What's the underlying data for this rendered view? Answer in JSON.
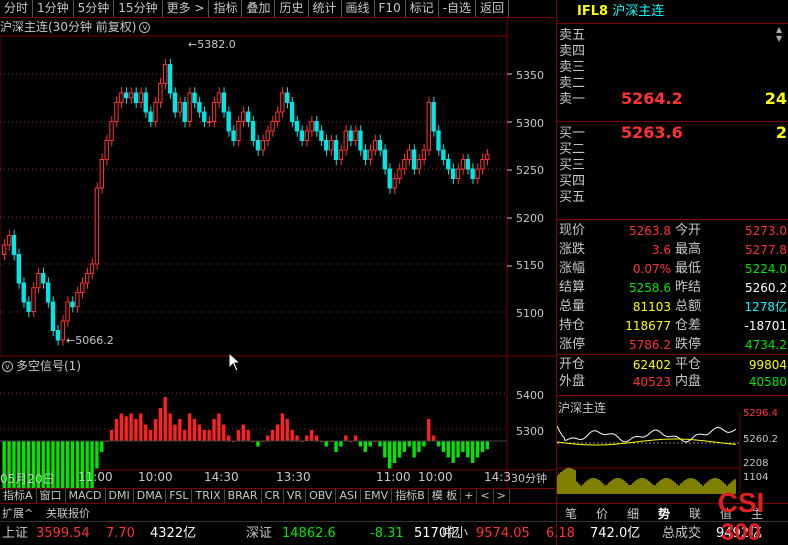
{
  "toolbar": [
    "分时",
    "1分钟",
    "5分钟",
    "15分钟",
    "更多 >",
    "指标",
    "叠加",
    "历史",
    "统计",
    "画线",
    "F10",
    "标记",
    "-自选",
    "返回"
  ],
  "chart_header": "沪深主连(30分钟 前复权)",
  "chart_header_icon": "v",
  "price_axis": [
    "5350",
    "5300",
    "5250",
    "5200",
    "5150",
    "5100"
  ],
  "high_label": "5382.0",
  "low_label": "5066.2",
  "indicator_header": "多空信号(1)",
  "indicator_axis": [
    "5400",
    "5300"
  ],
  "time_axis": [
    "05月20日",
    "11:00",
    "10:00",
    "14:30",
    "13:30",
    "11:00",
    "10:00",
    "14:3"
  ],
  "period_label": "30分钟",
  "chart_data": {
    "type": "candlestick",
    "title": "沪深主连(30分钟 前复权)",
    "ylim": [
      5060,
      5390
    ],
    "high": 5382.0,
    "low": 5066.2
  },
  "bottom_tabs": [
    "指标A",
    "窗口",
    "MACD",
    "DMI",
    "DMA",
    "FSL",
    "TRIX",
    "BRAR",
    "CR",
    "VR",
    "OBV",
    "ASI",
    "EMV",
    "指标B",
    "模 板",
    "+",
    "<",
    ">"
  ],
  "bottom_sub": [
    "扩展^",
    "关联报价"
  ],
  "side": {
    "code": "IFL8",
    "name": "沪深主连",
    "asks": [
      {
        "label": "卖五"
      },
      {
        "label": "卖四"
      },
      {
        "label": "卖三"
      },
      {
        "label": "卖二"
      },
      {
        "label": "卖一",
        "price": "5264.2",
        "vol": "24"
      }
    ],
    "bids": [
      {
        "label": "买一",
        "price": "5263.6",
        "vol": "2"
      },
      {
        "label": "买二"
      },
      {
        "label": "买三"
      },
      {
        "label": "买四"
      },
      {
        "label": "买五"
      }
    ],
    "stats": [
      {
        "l1": "现价",
        "v1": "5263.8",
        "l2": "今开",
        "v2": "5273.0"
      },
      {
        "l1": "涨跌",
        "v1": "3.6",
        "l2": "最高",
        "v2": "5277.8"
      },
      {
        "l1": "涨幅",
        "v1": "0.07%",
        "l2": "最低",
        "v2": "5224.0"
      },
      {
        "l1": "结算",
        "v1": "5258.6",
        "l2": "昨结",
        "v2": "5260.2"
      },
      {
        "l1": "总量",
        "v1": "81103",
        "l2": "总额",
        "v2": "1278亿"
      },
      {
        "l1": "持仓",
        "v1": "118677",
        "l2": "仓差",
        "v2": "-18701"
      },
      {
        "l1": "涨停",
        "v1": "5786.2",
        "l2": "跌停",
        "v2": "4734.2"
      }
    ],
    "extra": [
      {
        "l1": "开仓",
        "v1": "62402",
        "l2": "平仓",
        "v2": "99804"
      },
      {
        "l1": "外盘",
        "v1": "40523",
        "l2": "内盘",
        "v2": "40580"
      }
    ],
    "mini_title": "沪深主连",
    "mini_axis": [
      "5296.4",
      "5260.2",
      "2208",
      "1104"
    ],
    "side_tabs": [
      "笔",
      "价",
      "细",
      "势",
      "联",
      "值",
      "主"
    ]
  },
  "status": [
    {
      "label": "上证",
      "price": "3599.54",
      "chg": "7.70",
      "amt": "4322亿"
    },
    {
      "label": "深证",
      "price": "14862.6",
      "chg": "-8.31",
      "amt": "5170亿"
    },
    {
      "label": "中小",
      "price": "9574.05",
      "chg": "6.18",
      "amt": "742.0亿"
    },
    {
      "label": "总成交",
      "amt": "9492亿"
    }
  ],
  "watermark": "CSI 300"
}
